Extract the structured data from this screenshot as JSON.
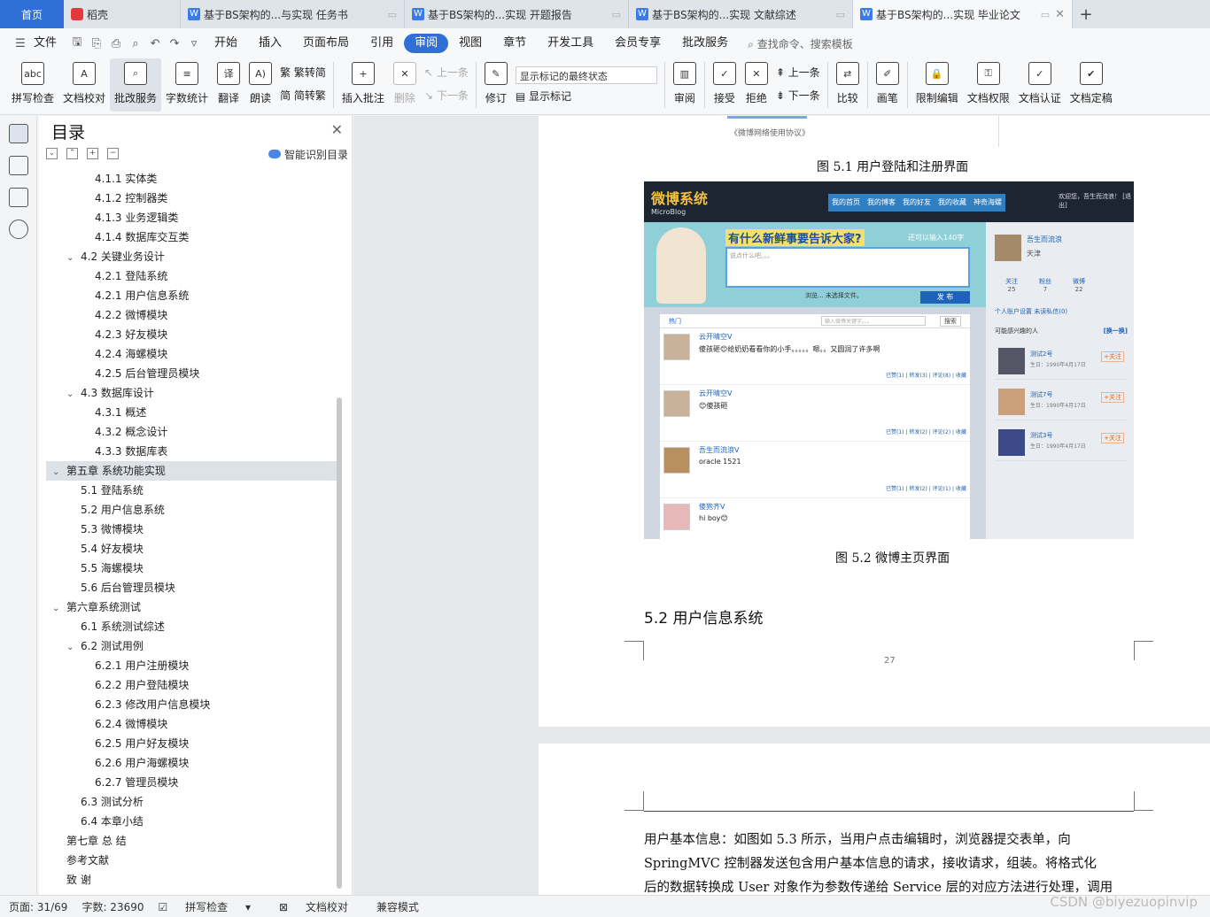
{
  "tabs": {
    "home": "首页",
    "daoke": "稻壳",
    "doc1": "基于BS架构的...与实现 任务书",
    "doc2": "基于BS架构的...实现 开题报告",
    "doc3": "基于BS架构的...实现 文献综述",
    "doc4": "基于BS架构的...实现 毕业论文",
    "new": "+"
  },
  "menu": {
    "file": "文件",
    "items": [
      "开始",
      "插入",
      "页面布局",
      "引用",
      "审阅",
      "视图",
      "章节",
      "开发工具",
      "会员专享",
      "批改服务"
    ],
    "search": "查找命令、搜索模板"
  },
  "ribbon": {
    "spell": "拼写检查",
    "proof": "文档校对",
    "review_service": "批改服务",
    "wordcount": "字数统计",
    "translate": "翻译",
    "read": "朗读",
    "trad": "繁转简",
    "simp": "简转繁",
    "insert_comment": "插入批注",
    "delete": "删除",
    "prev": "上一条",
    "next": "下一条",
    "track": "修订",
    "mark_state": "显示标记的最终状态",
    "show_marks": "显示标记",
    "review": "审阅",
    "accept": "接受",
    "reject": "拒绝",
    "prev2": "上一条",
    "next2": "下一条",
    "compare": "比较",
    "pen": "画笔",
    "restrict": "限制编辑",
    "permission": "文档权限",
    "certify": "文档认证",
    "finalize": "文档定稿"
  },
  "toc": {
    "title": "目录",
    "smart": "智能识别目录",
    "items": [
      "4.1.1  实体类",
      "4.1.2  控制器类",
      "4.1.3  业务逻辑类",
      "4.1.4  数据库交互类",
      "4.2  关键业务设计",
      "4.2.1  登陆系统",
      "4.2.1  用户信息系统",
      "4.2.2 微博模块",
      "4.2.3  好友模块",
      "4.2.4  海螺模块",
      "4.2.5  后台管理员模块",
      "4.3  数据库设计",
      "4.3.1  概述",
      "4.3.2  概念设计",
      "4.3.3  数据库表",
      "第五章  系统功能实现",
      "5.1  登陆系统",
      "5.2  用户信息系统",
      "5.3  微博模块",
      "5.4  好友模块",
      "5.5  海螺模块",
      "5.6  后台管理员模块",
      "第六章系统测试",
      "6.1  系统测试综述",
      "6.2  测试用例",
      "6.2.1 用户注册模块",
      "6.2.2 用户登陆模块",
      "6.2.3 修改用户信息模块",
      "6.2.4 微博模块",
      "6.2.5 用户好友模块",
      "6.2.6 用户海螺模块",
      "6.2.7 管理员模块",
      "6.3  测试分析",
      "6.4  本章小结",
      "第七章  总  结",
      "参考文献",
      "致    谢"
    ]
  },
  "doc": {
    "fig1_source": "《微博网络使用协议》",
    "fig1_caption": "图 5.1 用户登陆和注册界面",
    "fig2_caption": "图 5.2 微博主页界面",
    "heading": "5.2  用户信息系统",
    "page_number": "27",
    "para_lines": [
      "    用户基本信息：如图如 5.3 所示，当用户点击编辑时，浏览器提交表单，向",
      "SpringMVC 控制器发送包含用户基本信息的请求，接收请求，组装。将格式化",
      "后的数据转换成 User 对象作为参数传递给 Service 层的对应方法进行处理，调用"
    ]
  },
  "screenshot": {
    "logo": "微博系统",
    "logo_sub": "MicroBlog",
    "nav": [
      "我的首页",
      "我的博客",
      "我的好友",
      "我的收藏",
      "神奇海螺"
    ],
    "welcome": "欢迎您，吾生而流浪！ [退出]",
    "ask": "有什么新鲜事要告诉大家?",
    "count": "还可以输入140字",
    "input_placeholder": "说点什么吧。。。",
    "browse": "浏览...    未选择文件。",
    "post_btn": "发 布",
    "feed_tab": "热门",
    "feed_search": "输入微博关键字。。。",
    "feed_search_btn": "搜索",
    "posts": [
      {
        "user": "云开晴空V",
        "text": "傻孩砸😊给奶奶看看你的小手。。。。。嗯。。又圆润了许多啊",
        "actions": "已赞(1) | 转发(3) | 评论(8) | 收藏"
      },
      {
        "user": "云开晴空V",
        "text": "😊傻孩砸",
        "actions": "已赞(1) | 转发(2) | 评论(2) | 收藏"
      },
      {
        "user": "吾生而流浪V",
        "text": "oracle 1521",
        "actions": "已赞(1) | 转发(2) | 评论(1) | 收藏"
      },
      {
        "user": "傻狍齐V",
        "text": "hi boy😊",
        "actions": ""
      }
    ],
    "profile": {
      "name": "吾生而流浪",
      "city": "天津"
    },
    "stats": [
      {
        "label": "关注",
        "value": "25"
      },
      {
        "label": "粉丝",
        "value": "7"
      },
      {
        "label": "微博",
        "value": "22"
      }
    ],
    "links": "个人账户设置    未读私信(0)",
    "maybe": "可能感兴趣的人",
    "change": "[换一换]",
    "recs": [
      {
        "name": "测试2号",
        "birth": "生日：1990年4月17日",
        "follow": "+关注"
      },
      {
        "name": "测试7号",
        "birth": "生日：1990年4月17日",
        "follow": "+关注"
      },
      {
        "name": "测试3号",
        "birth": "生日：1990年4月17日",
        "follow": "+关注"
      }
    ]
  },
  "status": {
    "page": "页面: 31/69",
    "words": "字数: 23690",
    "spell": "拼写检查",
    "proof": "文档校对",
    "compat": "兼容模式",
    "watermark": "CSDN @biyezuopinvip"
  }
}
